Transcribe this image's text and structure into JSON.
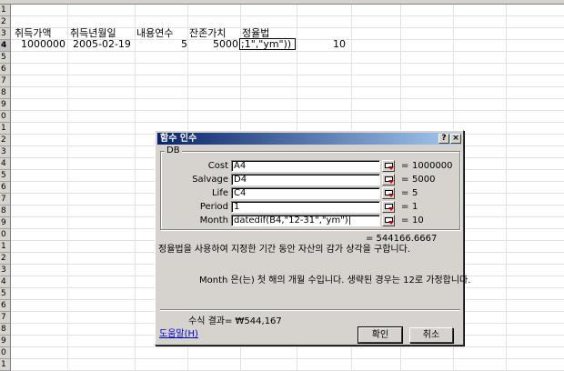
{
  "spreadsheet": {
    "row_numbers": [
      "1",
      "2",
      "3",
      "4",
      "5",
      "6",
      "7",
      "8",
      "9",
      "0",
      "1",
      "2",
      "3",
      "4",
      "5",
      "6",
      "7",
      "8",
      "9",
      "0",
      "1",
      "2",
      "3",
      "4",
      "5",
      "6",
      "7",
      "8",
      "9",
      "0",
      "1"
    ],
    "headers": {
      "acquisition_cost": "취득가액",
      "acquisition_date": "취득년월일",
      "useful_life": "내용연수",
      "salvage_value": "잔존가치",
      "declining_balance": "정율법"
    },
    "row4": {
      "acquisition_cost": "1000000",
      "acquisition_date": "2005-02-19",
      "useful_life": "5",
      "salvage_value": "5000",
      "formula_tail": ";1\",\"ym\"))",
      "extra_value": "10"
    }
  },
  "dialog": {
    "title": "함수 인수",
    "help_button": "?",
    "close_button": "×",
    "function_name": "DB",
    "args": [
      {
        "label": "Cost",
        "value": "A4",
        "result": "1000000"
      },
      {
        "label": "Salvage",
        "value": "D4",
        "result": "5000"
      },
      {
        "label": "Life",
        "value": "C4",
        "result": "5"
      },
      {
        "label": "Period",
        "value": "1",
        "result": "1"
      },
      {
        "label": "Month",
        "value": "datedif(B4,\"12-31\",\"ym\")|",
        "result": "10"
      }
    ],
    "equals": "=",
    "function_result": "= 544166.6667",
    "description": "정율법을 사용하여 지정한 기간 동안 자산의 감가 상각을 구합니다.",
    "arg_description": "Month 은(는) 첫 해의 개월 수입니다. 생략된 경우는 12로 가정합니다.",
    "formula_result": "수식 결과= ₩544,167",
    "help_link": "도움말(H)",
    "ok_button": "확인",
    "cancel_button": "취소"
  }
}
